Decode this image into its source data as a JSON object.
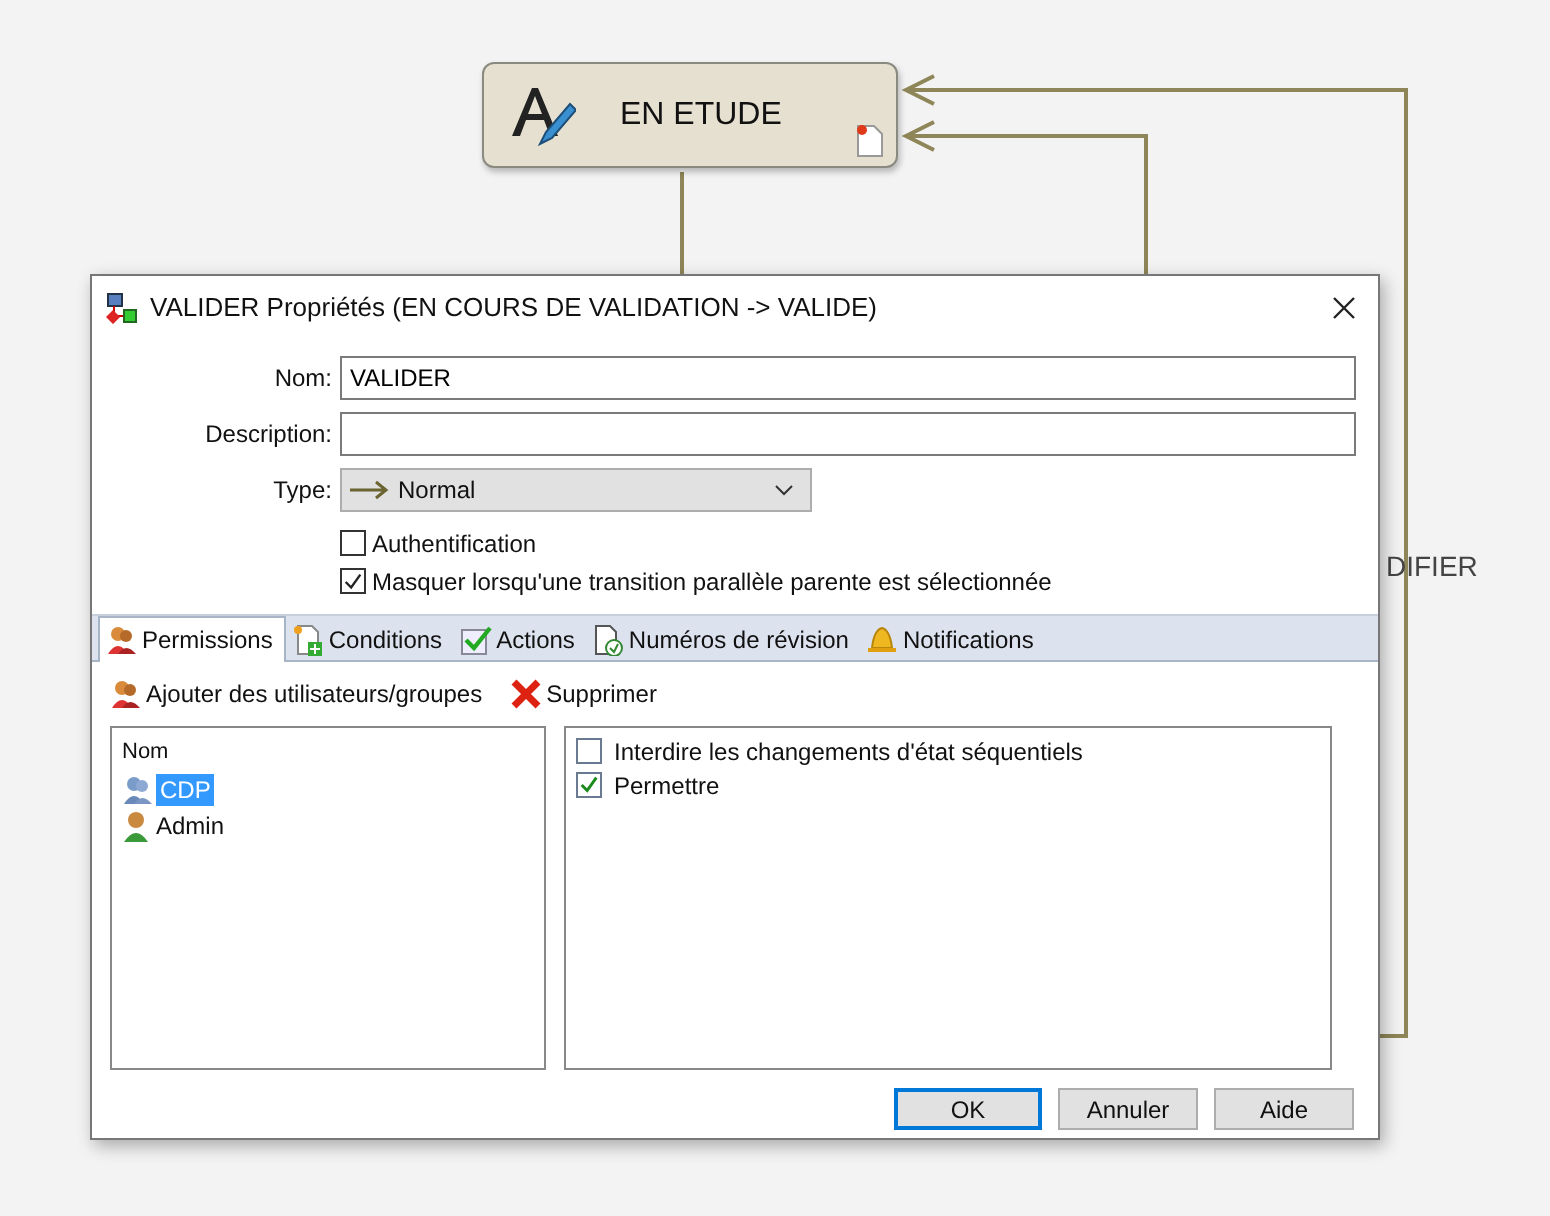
{
  "diagram": {
    "state_node": {
      "label": "EN ETUDE"
    },
    "edge_label": "DIFIER"
  },
  "dialog": {
    "title": "VALIDER Propriétés (EN COURS DE VALIDATION -> VALIDE)",
    "fields": [
      {
        "label": "Nom:",
        "value": "VALIDER"
      },
      {
        "label": "Description:"
      }
    ],
    "type": {
      "label": "Type:",
      "value": "Normal"
    },
    "options": [
      {
        "label": "Authentification",
        "checked": false
      },
      {
        "label": "Masquer lorsqu'une transition parallèle parente est sélectionnée",
        "checked": true
      }
    ],
    "tabs": [
      {
        "label": "Permissions",
        "selected": true
      },
      {
        "label": "Conditions",
        "selected": false
      },
      {
        "label": "Actions",
        "selected": false
      },
      {
        "label": "Numéros de révision",
        "selected": false
      },
      {
        "label": "Notifications",
        "selected": false
      }
    ],
    "toolbar": [
      {
        "kind": "add",
        "label": "Ajouter des utilisateurs/groupes"
      },
      {
        "kind": "delete",
        "label": "Supprimer"
      }
    ],
    "users": {
      "column": "Nom",
      "items": [
        {
          "kind": "group",
          "name": "CDP",
          "selected": true
        },
        {
          "kind": "user",
          "name": "Admin",
          "selected": false
        }
      ]
    },
    "permissions": [
      {
        "label": "Interdire les changements d'état séquentiels",
        "checked": false
      },
      {
        "label": "Permettre",
        "checked": true
      }
    ],
    "buttons": [
      {
        "label": "OK",
        "default": true
      },
      {
        "label": "Annuler",
        "default": false
      },
      {
        "label": "Aide",
        "default": false
      }
    ]
  }
}
